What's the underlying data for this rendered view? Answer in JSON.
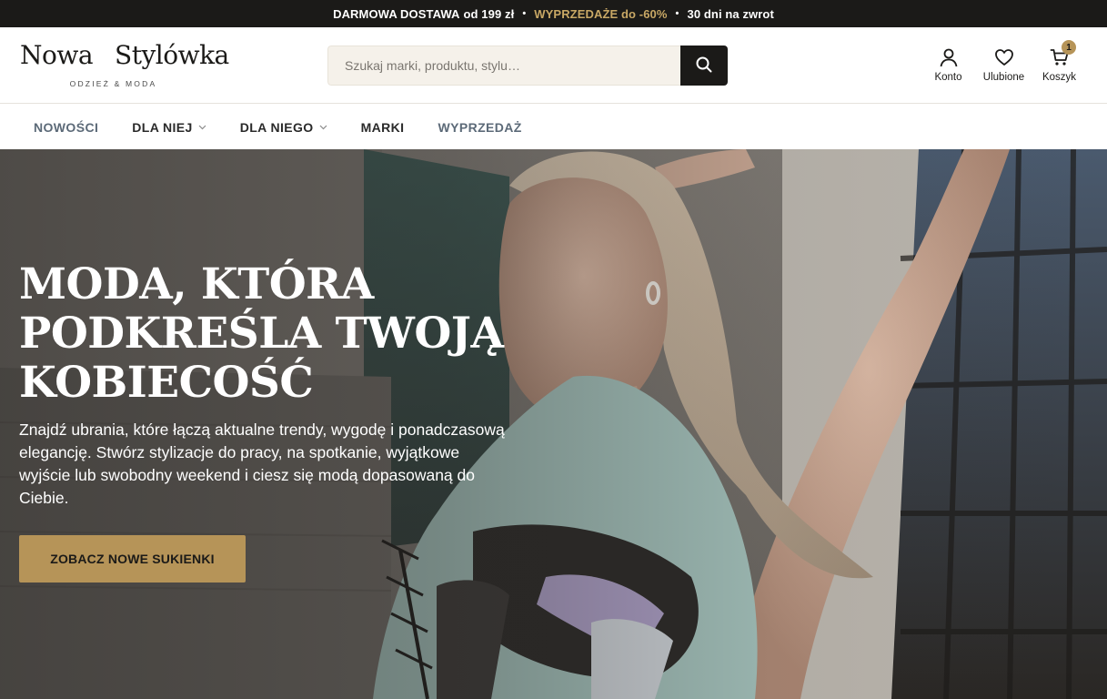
{
  "topbar": {
    "shipping_strong": "DARMOWA DOSTAWA",
    "shipping_rest": "od 199 zł",
    "sale": "WYPRZEDAŻE do -60%",
    "returns": "30 dni na zwrot",
    "separator": "•",
    "accent_color": "#c9a865"
  },
  "header": {
    "logo_part1": "Nowa",
    "logo_part2": "Stylówka",
    "logo_tagline": "ODZIEŻ & MODA",
    "search_placeholder": "Szukaj marki, produktu, stylu…",
    "search_icon": "search-icon",
    "actions": [
      {
        "label": "Konto",
        "icon": "user-icon"
      },
      {
        "label": "Ulubione",
        "icon": "heart-icon"
      },
      {
        "label": "Koszyk",
        "icon": "cart-icon",
        "badge": "1"
      }
    ]
  },
  "nav": {
    "items": [
      {
        "label": "NOWOŚCI"
      },
      {
        "label": "DLA NIEJ",
        "dropdown": true
      },
      {
        "label": "DLA NIEGO",
        "dropdown": true
      },
      {
        "label": "MARKI"
      },
      {
        "label": "WYPRZEDAŻ"
      }
    ]
  },
  "hero": {
    "title_lines": [
      "MODA, KTÓRA",
      "PODKREŚLA TWOJĄ",
      "KOBIECOŚĆ"
    ],
    "text": "Znajdź ubrania, które łączą aktualne trendy, wygodę i ponadczasową elegancję. Stwórz stylizacje do pracy, na spotkanie, wyjątkowe wyjście lub swobodny weekend i ciesz się modą dopasowaną do Ciebie.",
    "cta": "ZOBACZ NOWE SUKIENKI",
    "cta_color": "#b69458"
  },
  "colors": {
    "dark": "#1b1a18",
    "gold": "#b69458",
    "search_bg": "#f5f1ea",
    "nav_muted": "#5c6a78"
  }
}
